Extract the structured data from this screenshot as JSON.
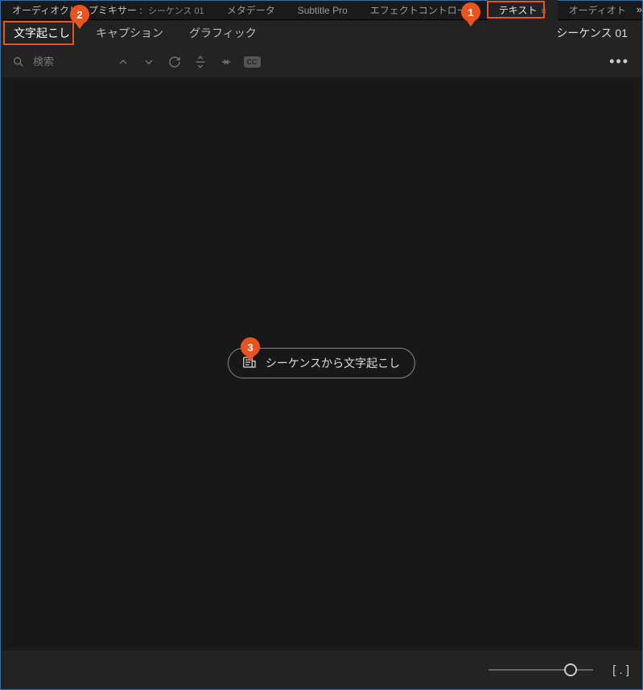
{
  "top_tabs": {
    "audio_mixer": "オーディオクリップミキサー :",
    "audio_mixer_sub": "シーケンス 01",
    "metadata": "メタデータ",
    "subtitle_pro": "Subtitle Pro",
    "effect_controls": "エフェクトコントロール",
    "text": "テキスト",
    "audio_track": "オーディオト"
  },
  "sub_tabs": {
    "transcription": "文字起こし",
    "captions": "キャプション",
    "graphics": "グラフィック"
  },
  "sequence_label": "シーケンス 01",
  "search": {
    "placeholder": "検索"
  },
  "cc_label": "CC",
  "transcribe_button": "シーケンスから文字起こし",
  "callouts": {
    "one": "1",
    "two": "2",
    "three": "3"
  },
  "icons": {
    "menu_glyph": "≡",
    "overflow": "»",
    "more": "•••",
    "fit": "[ . ]"
  }
}
